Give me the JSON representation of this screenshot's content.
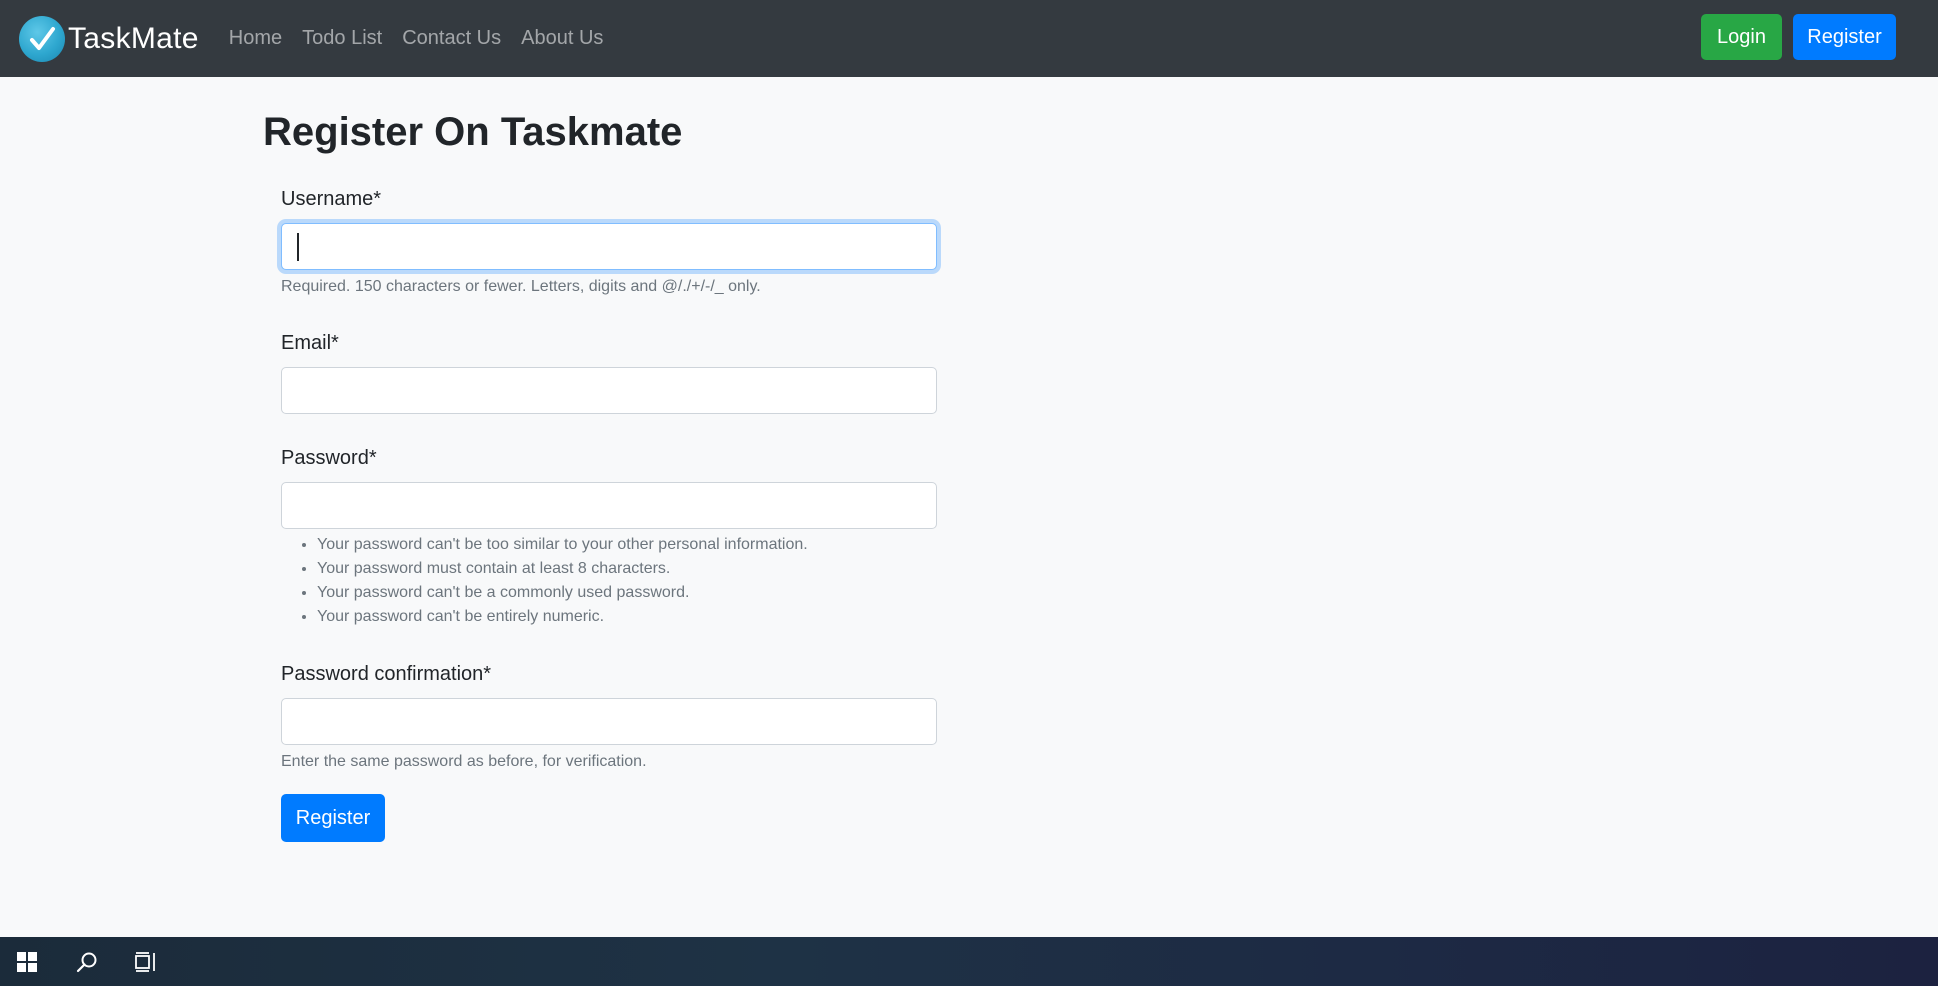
{
  "navbar": {
    "brand": "TaskMate",
    "links": [
      "Home",
      "Todo List",
      "Contact Us",
      "About Us"
    ],
    "login_label": "Login",
    "register_label": "Register"
  },
  "page": {
    "title": "Register On Taskmate"
  },
  "form": {
    "username": {
      "label": "Username*",
      "value": "",
      "help": "Required. 150 characters or fewer. Letters, digits and @/./+/-/_ only."
    },
    "email": {
      "label": "Email*",
      "value": ""
    },
    "password": {
      "label": "Password*",
      "value": "",
      "help_items": [
        "Your password can't be too similar to your other personal information.",
        "Your password must contain at least 8 characters.",
        "Your password can't be a commonly used password.",
        "Your password can't be entirely numeric."
      ]
    },
    "password_confirmation": {
      "label": "Password confirmation*",
      "value": "",
      "help": "Enter the same password as before, for verification."
    },
    "submit_label": "Register"
  },
  "taskbar": {
    "icons": [
      "windows-start-icon",
      "search-icon",
      "task-view-icon"
    ]
  },
  "colors": {
    "navbar_bg": "#343a40",
    "login_green": "#28a745",
    "primary_blue": "#007bff",
    "page_bg": "#f8f9fa"
  }
}
